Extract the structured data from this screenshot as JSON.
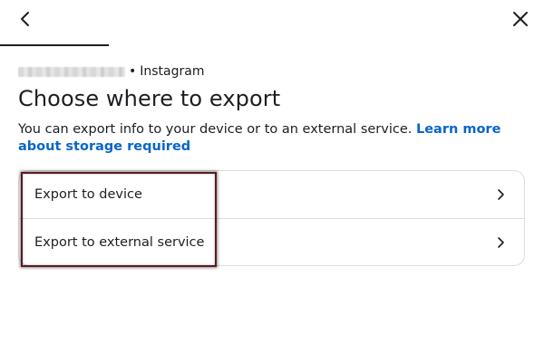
{
  "header": {
    "back_icon": "chevron-left-icon",
    "close_icon": "close-icon"
  },
  "account": {
    "name": "",
    "separator": "•",
    "platform": "Instagram"
  },
  "page": {
    "title": "Choose where to export",
    "description": "You can export info to your device or to an external service.",
    "learn_more_link": "Learn more about storage required"
  },
  "options": [
    {
      "label": "Export to device",
      "icon": "chevron-right-icon"
    },
    {
      "label": "Export to external service",
      "icon": "chevron-right-icon"
    }
  ],
  "colors": {
    "link": "#0866c9",
    "text": "#1c1e21",
    "border": "#dadde1",
    "highlight": "#5b1c21"
  }
}
